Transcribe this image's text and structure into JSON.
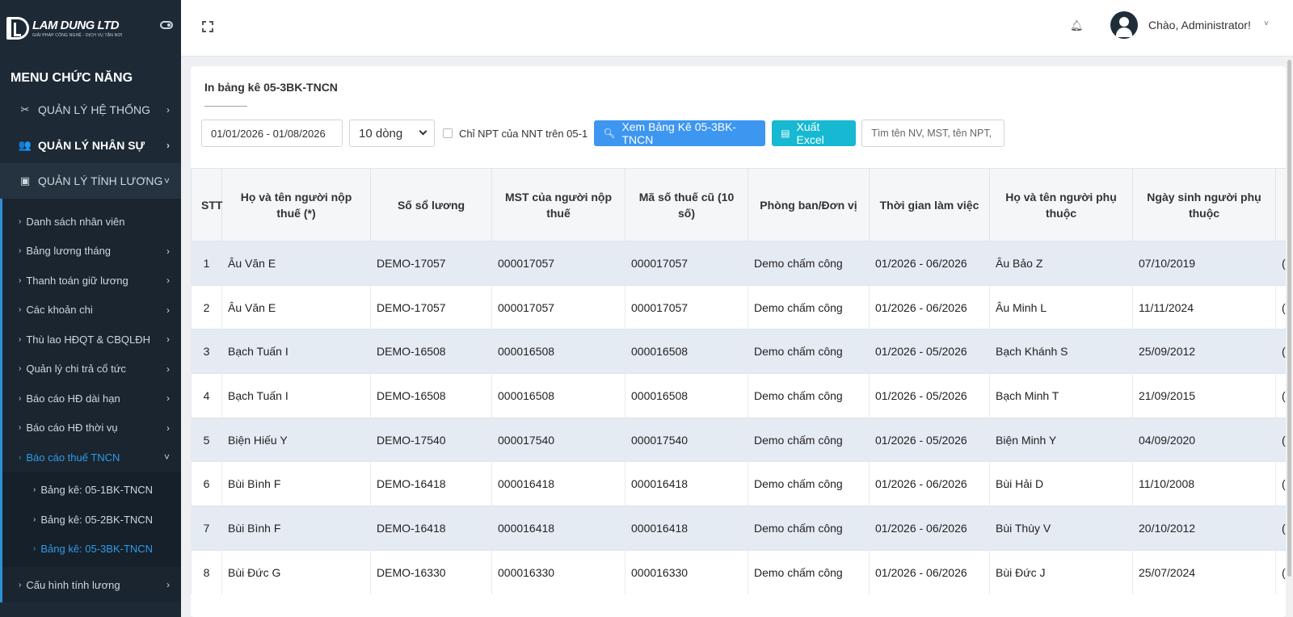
{
  "brand": {
    "name": "LAM DUNG LTD",
    "tagline": "GIẢI PHÁP CÔNG NGHỆ - DỊCH VỤ TẬN NƠI"
  },
  "sidebar": {
    "title": "MENU CHỨC NĂNG",
    "groups": [
      {
        "label": "QUẢN LÝ HỆ THỐNG",
        "icon": "tools-icon"
      },
      {
        "label": "QUẢN LÝ NHÂN SỰ",
        "icon": "users-icon"
      },
      {
        "label": "QUẢN LÝ TÍNH LƯƠNG",
        "icon": "money-icon"
      }
    ],
    "items": [
      "Danh sách nhân viên",
      "Bảng lương tháng",
      "Thanh toán giữ lương",
      "Các khoản chi",
      "Thù lao HĐQT & CBQLĐH",
      "Quản lý chi trả cổ tức",
      "Báo cáo HĐ dài hạn",
      "Báo cáo HĐ thời vụ",
      "Báo cáo thuế TNCN"
    ],
    "subitems": [
      "Bảng kê: 05-1BK-TNCN",
      "Bảng kê: 05-2BK-TNCN",
      "Bảng kê: 05-3BK-TNCN"
    ],
    "last_item": "Cấu hình tính lương"
  },
  "header": {
    "greeting": "Chào, Administrator!"
  },
  "page": {
    "title": "In bảng kê 05-3BK-TNCN",
    "date_range": "01/01/2026 - 01/08/2026",
    "rows_per_page": "10 dòng",
    "checkbox_label": "Chỉ NPT của NNT trên 05-1",
    "view_button": "Xem Bảng Kê 05-3BK-TNCN",
    "excel_button": "Xuất Excel",
    "search_placeholder": "Tìm tên NV, MST, tên NPT,"
  },
  "table": {
    "headers": [
      "STT",
      "Họ và tên người nộp thuế (*)",
      "Số sổ lương",
      "MST của người nộp thuế",
      "Mã số thuế cũ (10 số)",
      "Phòng ban/Đơn vị",
      "Thời gian làm việc",
      "Họ và tên người phụ thuộc",
      "Ngày sinh người phụ thuộc",
      ""
    ],
    "rows": [
      [
        "1",
        "Âu Văn E",
        "DEMO-17057",
        "000017057",
        "000017057",
        "Demo chấm công",
        "01/2026 - 06/2026",
        "Âu Bảo Z",
        "07/10/2019",
        "("
      ],
      [
        "2",
        "Âu Văn E",
        "DEMO-17057",
        "000017057",
        "000017057",
        "Demo chấm công",
        "01/2026 - 06/2026",
        "Âu Minh L",
        "11/11/2024",
        "("
      ],
      [
        "3",
        "Bạch Tuấn I",
        "DEMO-16508",
        "000016508",
        "000016508",
        "Demo chấm công",
        "01/2026 - 05/2026",
        "Bạch Khánh S",
        "25/09/2012",
        "("
      ],
      [
        "4",
        "Bạch Tuấn I",
        "DEMO-16508",
        "000016508",
        "000016508",
        "Demo chấm công",
        "01/2026 - 05/2026",
        "Bạch Minh T",
        "21/09/2015",
        "("
      ],
      [
        "5",
        "Biện Hiếu Y",
        "DEMO-17540",
        "000017540",
        "000017540",
        "Demo chấm công",
        "01/2026 - 05/2026",
        "Biện Minh Y",
        "04/09/2020",
        "("
      ],
      [
        "6",
        "Bùi Bình F",
        "DEMO-16418",
        "000016418",
        "000016418",
        "Demo chấm công",
        "01/2026 - 06/2026",
        "Bùi Hải D",
        "11/10/2008",
        "("
      ],
      [
        "7",
        "Bùi Bình F",
        "DEMO-16418",
        "000016418",
        "000016418",
        "Demo chấm công",
        "01/2026 - 06/2026",
        "Bùi Thùy V",
        "20/10/2012",
        "("
      ],
      [
        "8",
        "Bùi Đức G",
        "DEMO-16330",
        "000016330",
        "000016330",
        "Demo chấm công",
        "01/2026 - 06/2026",
        "Bùi Đức J",
        "25/07/2024",
        "("
      ]
    ]
  }
}
